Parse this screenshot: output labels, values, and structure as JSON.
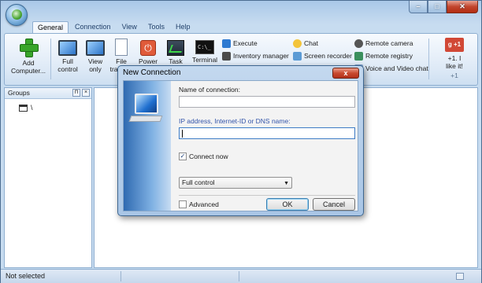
{
  "tabs": [
    "General",
    "Connection",
    "View",
    "Tools",
    "Help"
  ],
  "window_controls": {
    "minimize": "–",
    "maximize": "□",
    "close": "✕"
  },
  "ribbon": {
    "add_computer": "Add\nComputer...",
    "full_control": "Full\ncontrol",
    "view_only": "View\nonly",
    "file_transfer": "File\ntransfer",
    "power": "Power",
    "task_manager": "Task",
    "terminal": "Terminal",
    "execute": "Execute",
    "inventory_manager": "Inventory manager",
    "chat": "Chat",
    "screen_recorder": "Screen recorder",
    "remote_camera": "Remote camera",
    "remote_registry": "Remote registry",
    "voice_video_chat": "Voice and Video chat",
    "plus_one": {
      "badge": "g +1",
      "label": "+1. I\nlike it!",
      "count": "+1"
    }
  },
  "groups": {
    "title": "Groups",
    "tree_root": "\\"
  },
  "status": {
    "text": "Not selected"
  },
  "dialog": {
    "title": "New Connection",
    "close": "x",
    "name_label": "Name of connection:",
    "name_value": "",
    "ip_label": "IP address, Internet-ID or DNS name:",
    "ip_value": "",
    "connect_now_label": "Connect now",
    "connect_now_checked": true,
    "mode_selected": "Full control",
    "advanced_label": "Advanced",
    "advanced_checked": false,
    "ok": "OK",
    "cancel": "Cancel"
  },
  "icons": {
    "add": "green-plus-icon",
    "monitor": "monitor-icon",
    "file": "file-icon",
    "power": "power-icon",
    "task": "task-manager-icon",
    "terminal": "terminal-icon",
    "execute": "execute-icon",
    "inventory": "inventory-icon",
    "chat": "chat-icon",
    "recorder": "screen-recorder-icon",
    "camera": "camera-icon",
    "registry": "registry-icon",
    "voice": "voice-video-icon"
  },
  "colors": {
    "accent": "#2f6ea8",
    "close_red": "#c2452d",
    "plus_green": "#38a52a",
    "gplus_red": "#d14836"
  }
}
